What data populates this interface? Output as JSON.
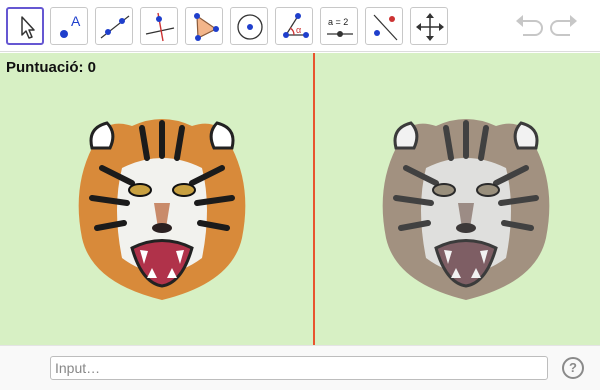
{
  "toolbar": {
    "tools": [
      {
        "name": "move-tool",
        "active": true
      },
      {
        "name": "point-tool"
      },
      {
        "name": "line-tool"
      },
      {
        "name": "perpendicular-line-tool"
      },
      {
        "name": "polygon-tool"
      },
      {
        "name": "circle-tool"
      },
      {
        "name": "angle-tool"
      },
      {
        "name": "slider-tool",
        "label": "a = 2"
      },
      {
        "name": "reflect-tool"
      },
      {
        "name": "move-graphics-view-tool"
      }
    ],
    "point_label": "A",
    "angle_label": "α",
    "slider_label": "a = 2"
  },
  "canvas": {
    "score_text": "Puntuació: 0",
    "divider_color": "#e8542e",
    "background": "#d7f0c4"
  },
  "input_bar": {
    "placeholder": "Input…",
    "help_glyph": "?"
  }
}
